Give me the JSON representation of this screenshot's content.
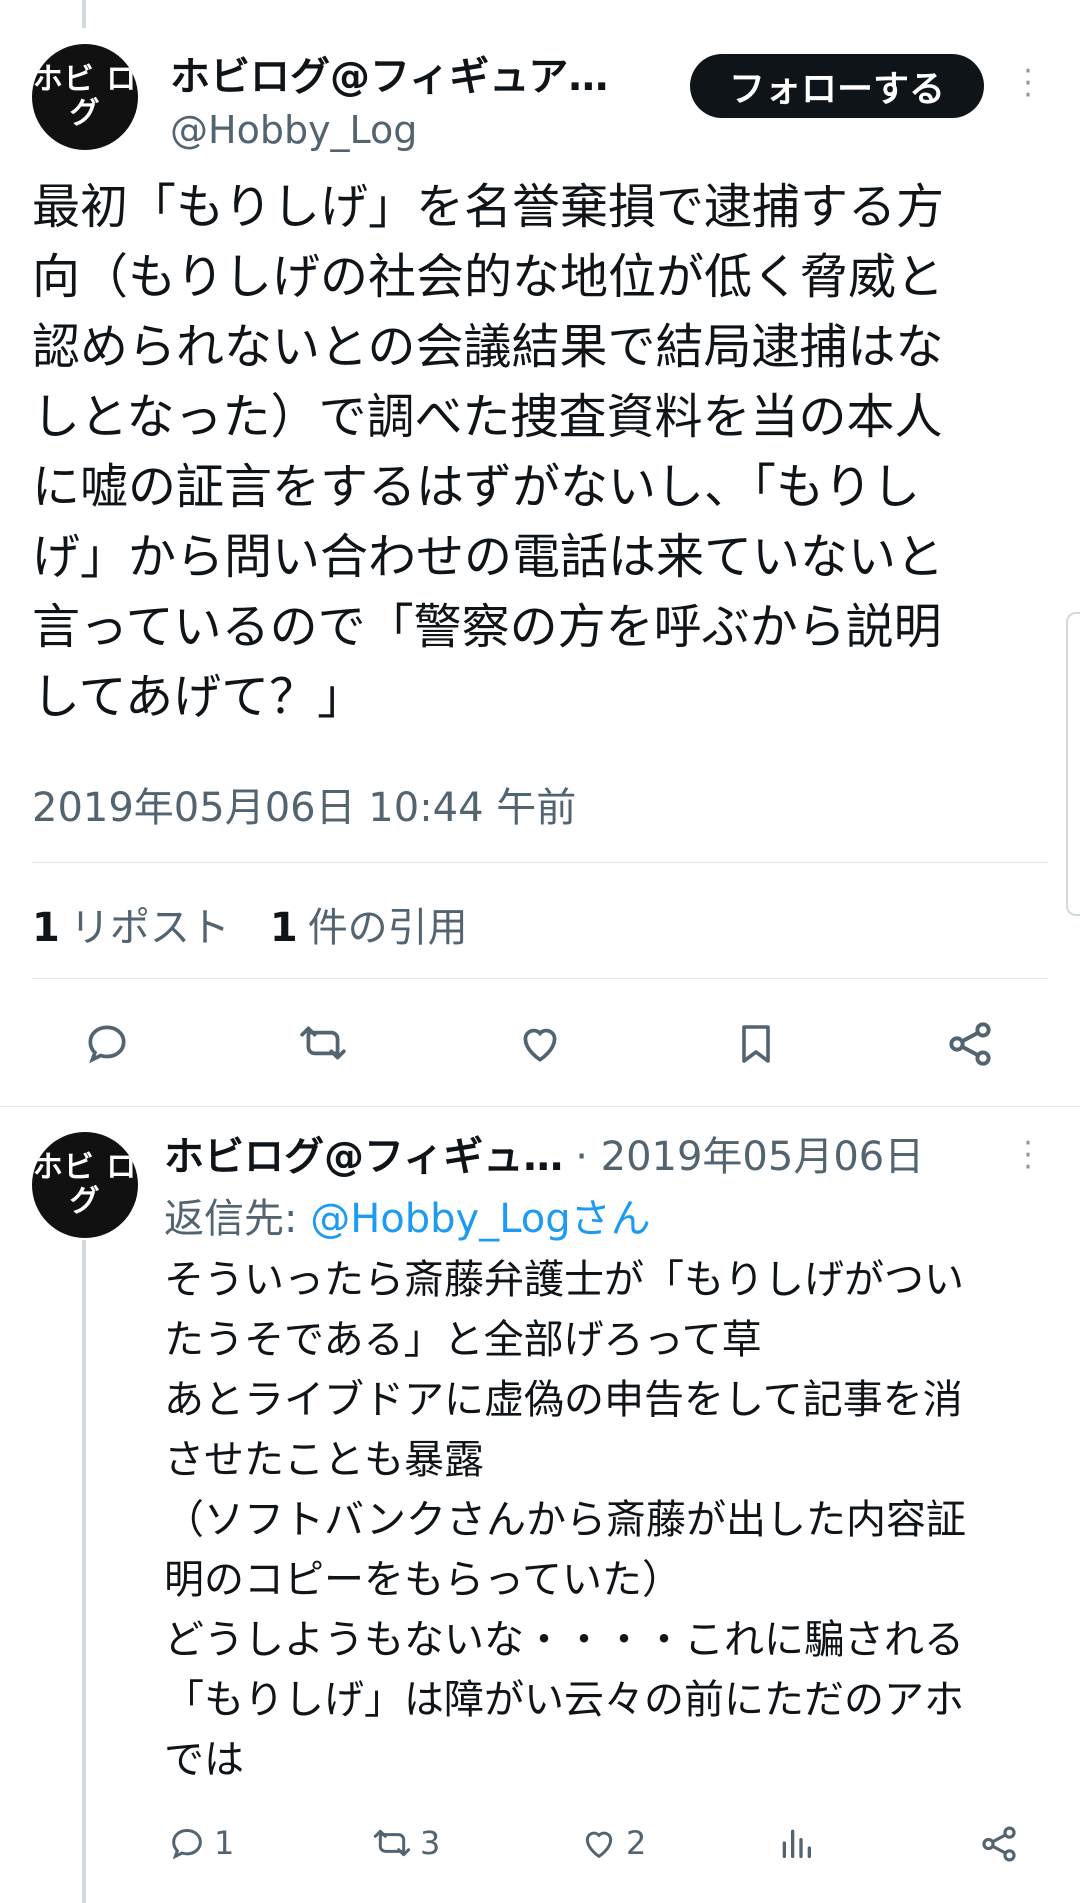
{
  "main_tweet": {
    "display_name": "ホビログ@フィギュア…",
    "handle": "@Hobby_Log",
    "avatar_text": "ホビ ログ",
    "follow_label": "フォローする",
    "body": "最初「もりしげ」を名誉棄損で逮捕する方\n向（もりしげの社会的な地位が低く脅威と\n認められないとの会議結果で結局逮捕はな\nしとなった）で調べた捜査資料を当の本人\nに嘘の証言をするはずがないし、「もりし\nげ」から問い合わせの電話は来ていないと\n言っているので「警察の方を呼ぶから説明\nしてあげて？」",
    "timestamp": "2019年05月06日 10:44 午前",
    "repost_count": "1",
    "repost_label": "リポスト",
    "quote_count": "1",
    "quote_label": "件の引用",
    "actions": [
      "reply-icon",
      "repost-icon",
      "like-icon",
      "bookmark-icon",
      "share-icon"
    ]
  },
  "reply_tweet": {
    "display_name": "ホビログ@フィギュ…",
    "date": "· 2019年05月06日",
    "avatar_text": "ホビ ログ",
    "replying_prefix": "返信先: ",
    "replying_to": "@Hobby_Logさん",
    "body": "そういったら斎藤弁護士が「もりしげがつい\nたうそである」と全部げろって草\nあとライブドアに虚偽の申告をして記事を消\nさせたことも暴露\n（ソフトバンクさんから斎藤が出した内容証\n明のコピーをもらっていた）\nどうしようもないな・・・・これに騙される\n「もりしげ」は障がい云々の前にただのアホ\nでは",
    "reply_count": "1",
    "repost_count": "3",
    "like_count": "2"
  },
  "colors": {
    "text": "#0f1419",
    "secondary": "#536471",
    "link": "#1d9bf0",
    "divider": "#e1e8ed"
  }
}
